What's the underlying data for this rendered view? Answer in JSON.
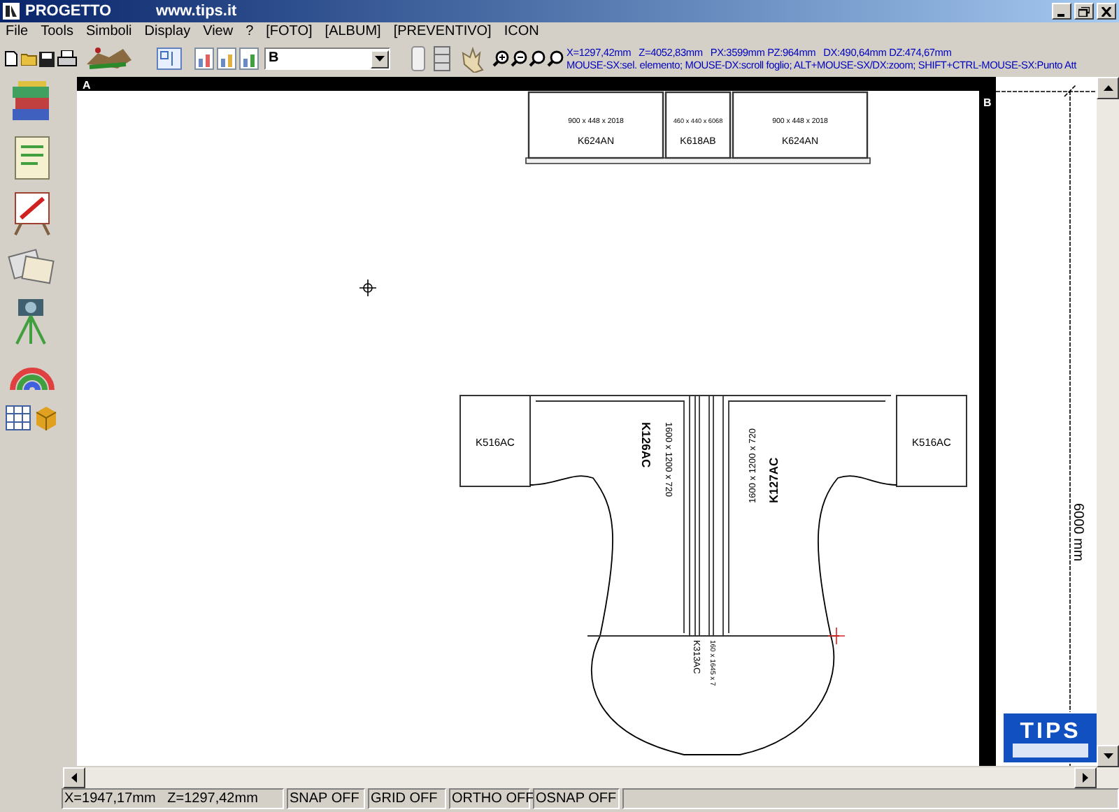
{
  "window": {
    "title": "PROGETTO",
    "url": "www.tips.it"
  },
  "menu": [
    "File",
    "Tools",
    "Simboli",
    "Display",
    "View",
    "?",
    "[FOTO]",
    "[ALBUM]",
    "[PREVENTIVO]",
    "ICON"
  ],
  "toolbar": {
    "layer_select": "B",
    "coords": "X=1297,42mm   Z=4052,83mm   PX:3599mm PZ:964mm   DX:490,64mm DZ:474,67mm",
    "hint": "MOUSE-SX:sel. elemento; MOUSE-DX:scroll foglio; ALT+MOUSE-SX/DX:zoom; SHIFT+CTRL-MOUSE-SX:Punto Att"
  },
  "drawing": {
    "corner_a": "A",
    "corner_b": "B",
    "dimension": "6000 mm",
    "wall_units": [
      {
        "size": "900 x 448 x 2018",
        "code": "K624AN"
      },
      {
        "size": "460 x 440 x 6068",
        "code": "K618AB"
      },
      {
        "size": "900 x 448 x 2018",
        "code": "K624AN"
      }
    ],
    "side_units": [
      "K516AC",
      "K516AC"
    ],
    "desks": [
      {
        "code": "K126AC",
        "size": "1600 x 1200 x 720"
      },
      {
        "code": "K127AC",
        "size": "1600 x 1200 x 720"
      }
    ],
    "connector": {
      "code": "K313AC",
      "size": "160 x 1645 x 7"
    }
  },
  "logo": {
    "text": "TIPS"
  },
  "status_bar": {
    "coords": "X=1947,17mm   Z=1297,42mm",
    "flags": [
      "SNAP OFF",
      "GRID OFF",
      "ORTHO OFF",
      "OSNAP OFF"
    ]
  }
}
